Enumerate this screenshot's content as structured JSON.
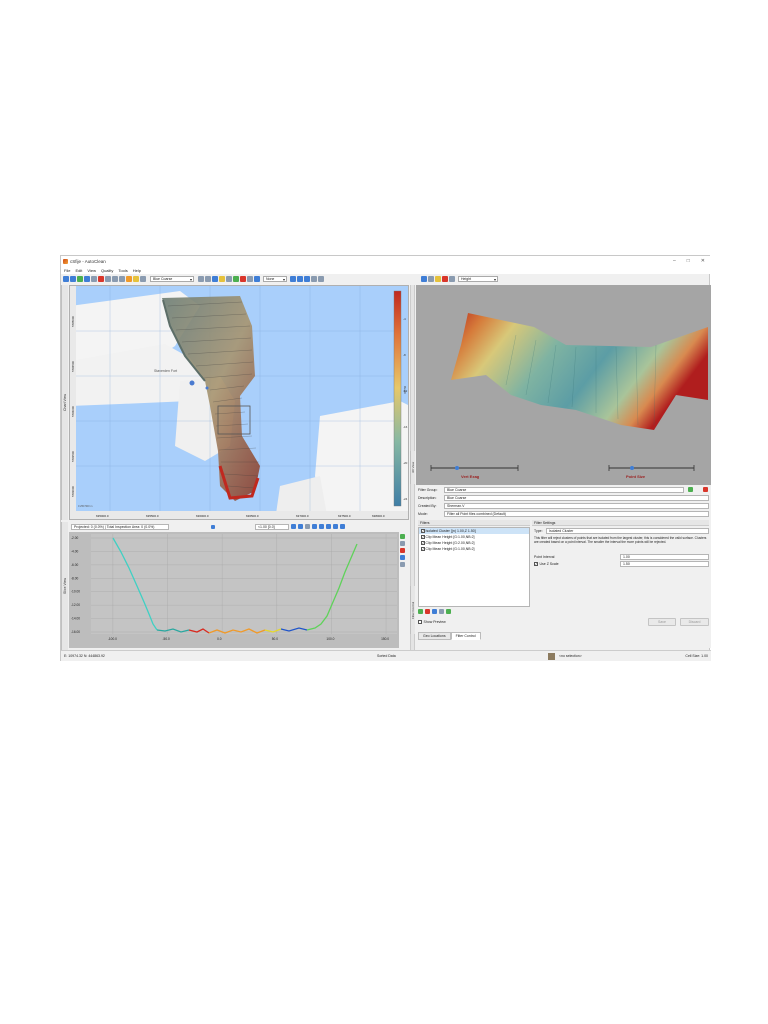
{
  "window": {
    "title": "cSfije - AutoClean",
    "controls": [
      "–",
      "□",
      "✕"
    ]
  },
  "menu": [
    "File",
    "Edit",
    "View",
    "Quality",
    "Tools",
    "Help"
  ],
  "toolbar": {
    "combo_main": "Blue Coarse",
    "combo_right": "None",
    "combo_3d": "Height"
  },
  "map": {
    "side_tab": "Chart View",
    "place_label": "Staverden Fort",
    "y_ticks": [
      "5785000",
      "5784500",
      "5784000",
      "5783500",
      "5783000"
    ],
    "x_ticks": [
      "635000.0",
      "635500.0",
      "636000.0",
      "636500.0",
      "637000.0",
      "637500.0",
      "638000.0"
    ],
    "colorbar_label": "Depth",
    "colorbar_ticks": [
      "-4",
      "-8",
      "-12",
      "-16",
      "-20",
      "-24"
    ],
    "scale_text": "0  250  500 m"
  },
  "slice": {
    "side_tab": "Slice View",
    "toolbar_left": "Projected: 0 (0.0%) | Total Inspection Area: 0 (0.0%)",
    "toolbar_value": "<1.00 [0.0]",
    "y_ticks": [
      "-2.00",
      "-4.00",
      "-6.00",
      "-8.00",
      "-10.00",
      "-12.00",
      "-14.00",
      "-16.00"
    ],
    "x_ticks": [
      "-100.0",
      "-50.0",
      "0.0",
      "50.0",
      "100.0",
      "150.0"
    ],
    "x_tick_values": [
      -120,
      -80,
      -40,
      0,
      40,
      80,
      120,
      160
    ]
  },
  "view3d": {
    "side_tab": "3D View",
    "slider1_label": "Vert Exag",
    "slider2_label": "Point Size"
  },
  "filter": {
    "side_tab": "Filter Control",
    "group_label": "Filter Group:",
    "group_value": "Blue Coarse",
    "desc_label": "Description:",
    "desc_value": "Blue Coarse",
    "created_label": "Created By:",
    "created_value": "Sherman.V",
    "mode_label": "Mode:",
    "mode_value": "Filter all Point files combined (Default)",
    "filters_header": "Filters",
    "filters": [
      {
        "label": "Isolated Cluster [(n) 1.00,Z 1.50]",
        "checked": true
      },
      {
        "label": "Clip Mean Height [G:1.00,NB:2]",
        "checked": true
      },
      {
        "label": "Clip Mean Height [G:2.00,NB:2]",
        "checked": true
      },
      {
        "label": "Clip Mean Height [G:1.00,NB:2]",
        "checked": true
      }
    ],
    "settings_header": "Filter Settings",
    "type_label": "Type:",
    "type_value": "Isolated Cluster",
    "description_text": "This filter will reject clusters of points that are isolated from the largest cluster, this is considered the valid surface. Clusters are created based on a point interval. The smaller the interval the more points will be rejected.",
    "point_interval_label": "Point Interval",
    "point_interval_value": "1.00",
    "use_z_scale_label": "Use Z Scale",
    "use_z_scale_value": "1.50",
    "show_preview_label": "Show Preview",
    "save_label": "Save",
    "discard_label": "Discard",
    "tabs": [
      "Geo Locations",
      "Filter Control"
    ]
  },
  "status": {
    "coords": "E: 10974.32   N: 444863.92",
    "mode": "Sorted Data",
    "selection": "<no selection>",
    "cell_size": "Cell Size: 1.00"
  }
}
